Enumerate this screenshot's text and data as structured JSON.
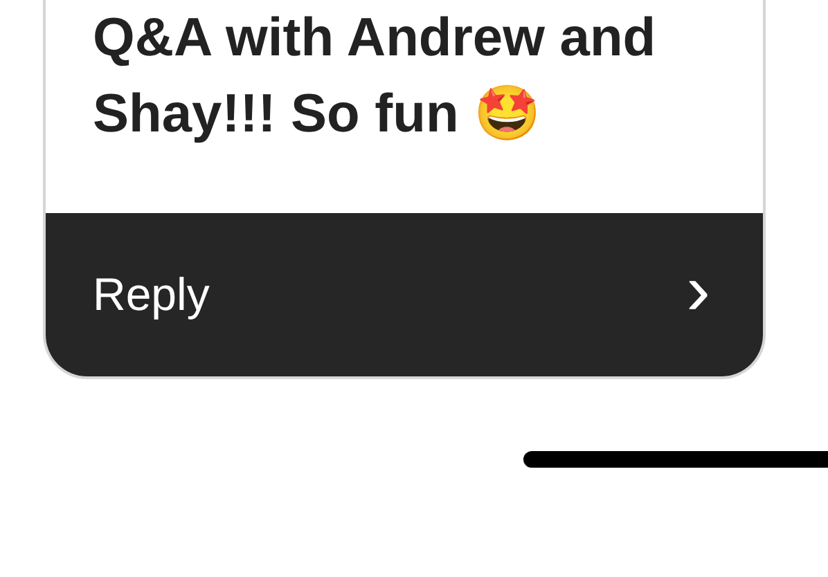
{
  "message": {
    "text": "Q&A with Andrew and Shay!!! So fun 🤩"
  },
  "reply_bar": {
    "label": "Reply",
    "chevron": "›"
  }
}
